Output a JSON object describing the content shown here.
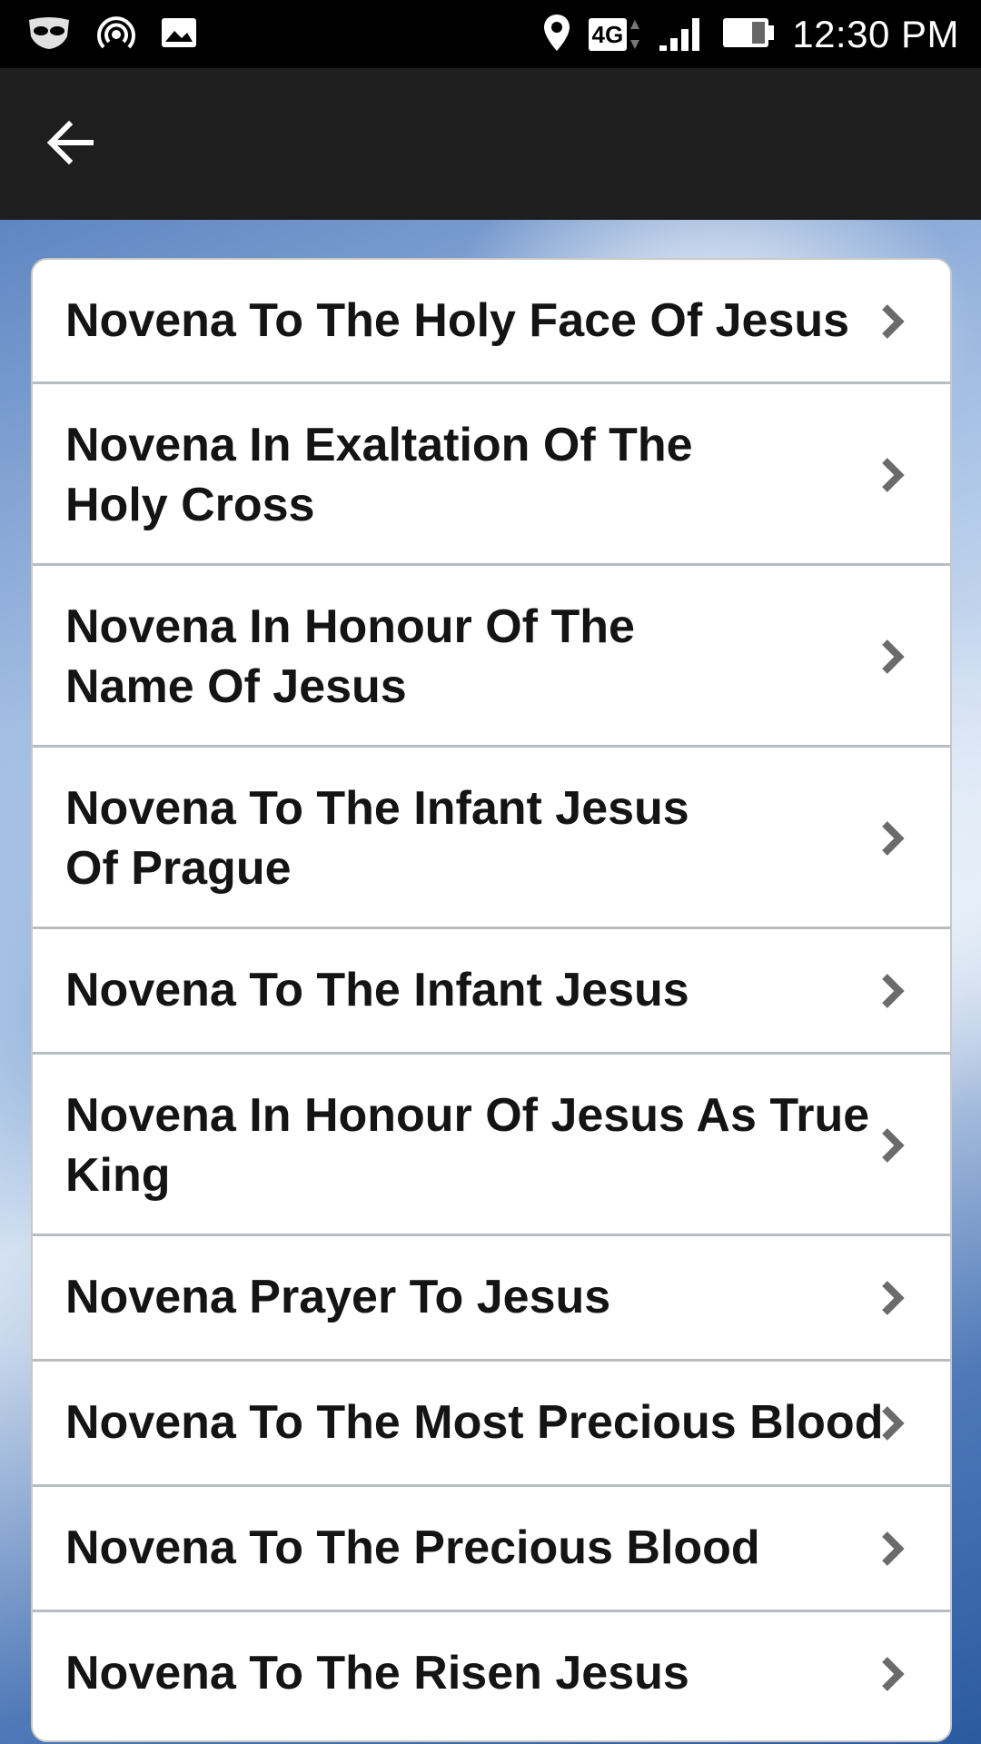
{
  "status_bar": {
    "time": "12:30 PM",
    "network": "4G",
    "icons": [
      "mask-icon",
      "hotspot-icon",
      "image-icon",
      "location-icon",
      "network-4g-icon",
      "signal-icon",
      "battery-icon"
    ]
  },
  "app_bar": {
    "back_icon": "arrow-left-icon"
  },
  "novenas": [
    {
      "label": "Novena To The Holy Face Of Jesus"
    },
    {
      "label": "Novena In Exaltation Of The Holy Cross"
    },
    {
      "label": "Novena In Honour Of The Name Of Jesus"
    },
    {
      "label": "Novena To The Infant Jesus Of Prague"
    },
    {
      "label": "Novena To The Infant Jesus"
    },
    {
      "label": "Novena In Honour Of Jesus As True King"
    },
    {
      "label": "Novena Prayer To Jesus"
    },
    {
      "label": "Novena To The Most Precious Blood"
    },
    {
      "label": "Novena To The Precious Blood"
    },
    {
      "label": "Novena To The Risen Jesus"
    }
  ],
  "item_icon": "chevron-right-icon",
  "colors": {
    "status_bar": "#000000",
    "app_bar": "#1e1e1e",
    "item_text": "#141414",
    "divider": "#b9bdc2"
  }
}
